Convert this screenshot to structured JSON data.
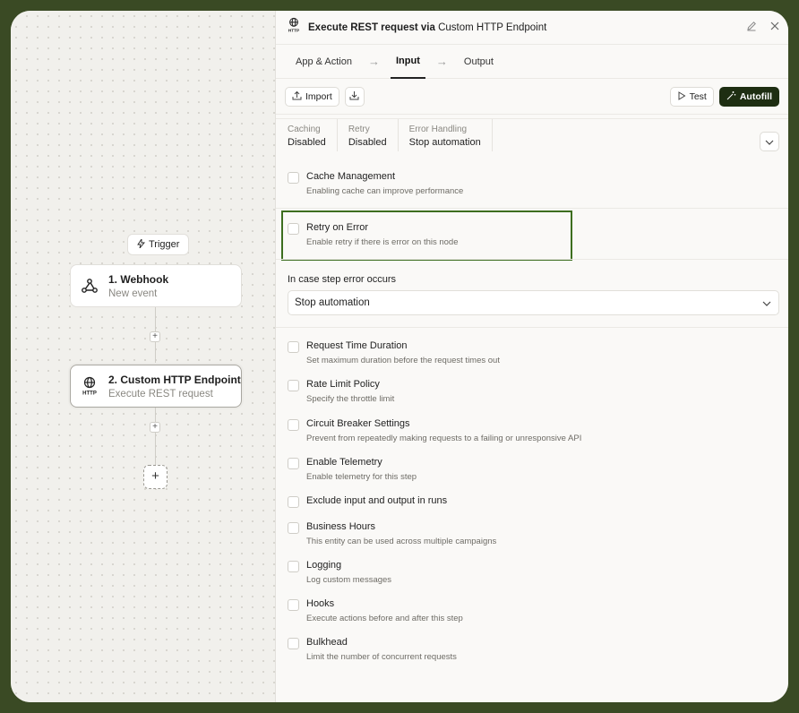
{
  "canvas": {
    "trigger_chip": "Trigger",
    "nodes": [
      {
        "title": "1. Webhook",
        "subtitle": "New event"
      },
      {
        "title": "2. Custom HTTP Endpoint",
        "subtitle": "Execute REST request"
      }
    ],
    "add_step": "+"
  },
  "panel": {
    "title_main": "Execute REST request via ",
    "title_app": "Custom HTTP Endpoint",
    "tabs": [
      {
        "label": "App & Action"
      },
      {
        "label": "Input"
      },
      {
        "label": "Output"
      }
    ],
    "toolbar": {
      "import": "Import",
      "test": "Test",
      "autofill": "Autofill"
    },
    "summary": [
      {
        "label": "Caching",
        "value": "Disabled"
      },
      {
        "label": "Retry",
        "value": "Disabled"
      },
      {
        "label": "Error Handling",
        "value": "Stop automation"
      }
    ],
    "options": [
      {
        "title": "Cache Management",
        "desc": "Enabling cache can improve performance"
      },
      {
        "title": "Retry on Error",
        "desc": "Enable retry if there is error on this node"
      },
      {
        "title": "Request Time Duration",
        "desc": "Set maximum duration before the request times out"
      },
      {
        "title": "Rate Limit Policy",
        "desc": "Specify the throttle limit"
      },
      {
        "title": "Circuit Breaker Settings",
        "desc": "Prevent from repeatedly making requests to a failing or unresponsive API"
      },
      {
        "title": "Enable Telemetry",
        "desc": "Enable telemetry for this step"
      },
      {
        "title": "Exclude input and output in runs",
        "desc": ""
      },
      {
        "title": "Business Hours",
        "desc": "This entity can be used across multiple campaigns"
      },
      {
        "title": "Logging",
        "desc": "Log custom messages"
      },
      {
        "title": "Hooks",
        "desc": "Execute actions before and after this step"
      },
      {
        "title": "Bulkhead",
        "desc": "Limit the number of concurrent requests"
      }
    ],
    "error_select": {
      "label": "In case step error occurs",
      "value": "Stop automation"
    }
  },
  "colors": {
    "accent": "#1e2e12",
    "highlight": "#3d6e1f"
  }
}
